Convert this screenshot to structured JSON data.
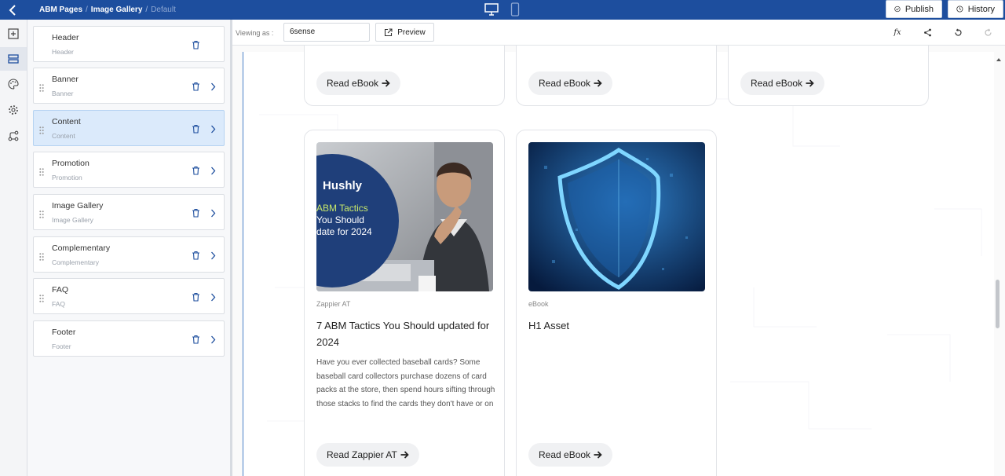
{
  "topbar": {
    "breadcrumb": [
      "ABM Pages",
      "Image Gallery",
      "Default"
    ],
    "publish_label": "Publish",
    "history_label": "History"
  },
  "layers": [
    {
      "name": "Header",
      "type": "Header"
    },
    {
      "name": "Banner",
      "type": "Banner"
    },
    {
      "name": "Content",
      "type": "Content"
    },
    {
      "name": "Promotion",
      "type": "Promotion"
    },
    {
      "name": "Image Gallery",
      "type": "Image Gallery"
    },
    {
      "name": "Complementary",
      "type": "Complementary"
    },
    {
      "name": "FAQ",
      "type": "FAQ"
    },
    {
      "name": "Footer",
      "type": "Footer"
    }
  ],
  "toolbar": {
    "viewing_label": "Viewing as :",
    "viewing_value": "6sense",
    "preview_label": "Preview",
    "fx_label": "fx"
  },
  "cards_top": [
    {
      "button": "Read eBook"
    },
    {
      "button": "Read eBook"
    },
    {
      "button": "Read eBook"
    }
  ],
  "cards": [
    {
      "type": "Zappier AT",
      "title": "7 ABM Tactics You Should updated for 2024",
      "description": "Have you ever collected baseball cards? Some baseball card collectors purchase dozens of card packs at the store, then spend hours sifting through those stacks to find the cards they don't have or on",
      "button": "Read Zappier AT",
      "image": {
        "brand": "Hushly",
        "line1": "ABM Tactics",
        "line2": "You Should",
        "line3": "date for 2024"
      }
    },
    {
      "type": "eBook",
      "title": "H1 Asset",
      "description": "",
      "button": "Read eBook"
    }
  ],
  "colors": {
    "brand": "#1d4e9e",
    "selected": "#dbeafb"
  }
}
